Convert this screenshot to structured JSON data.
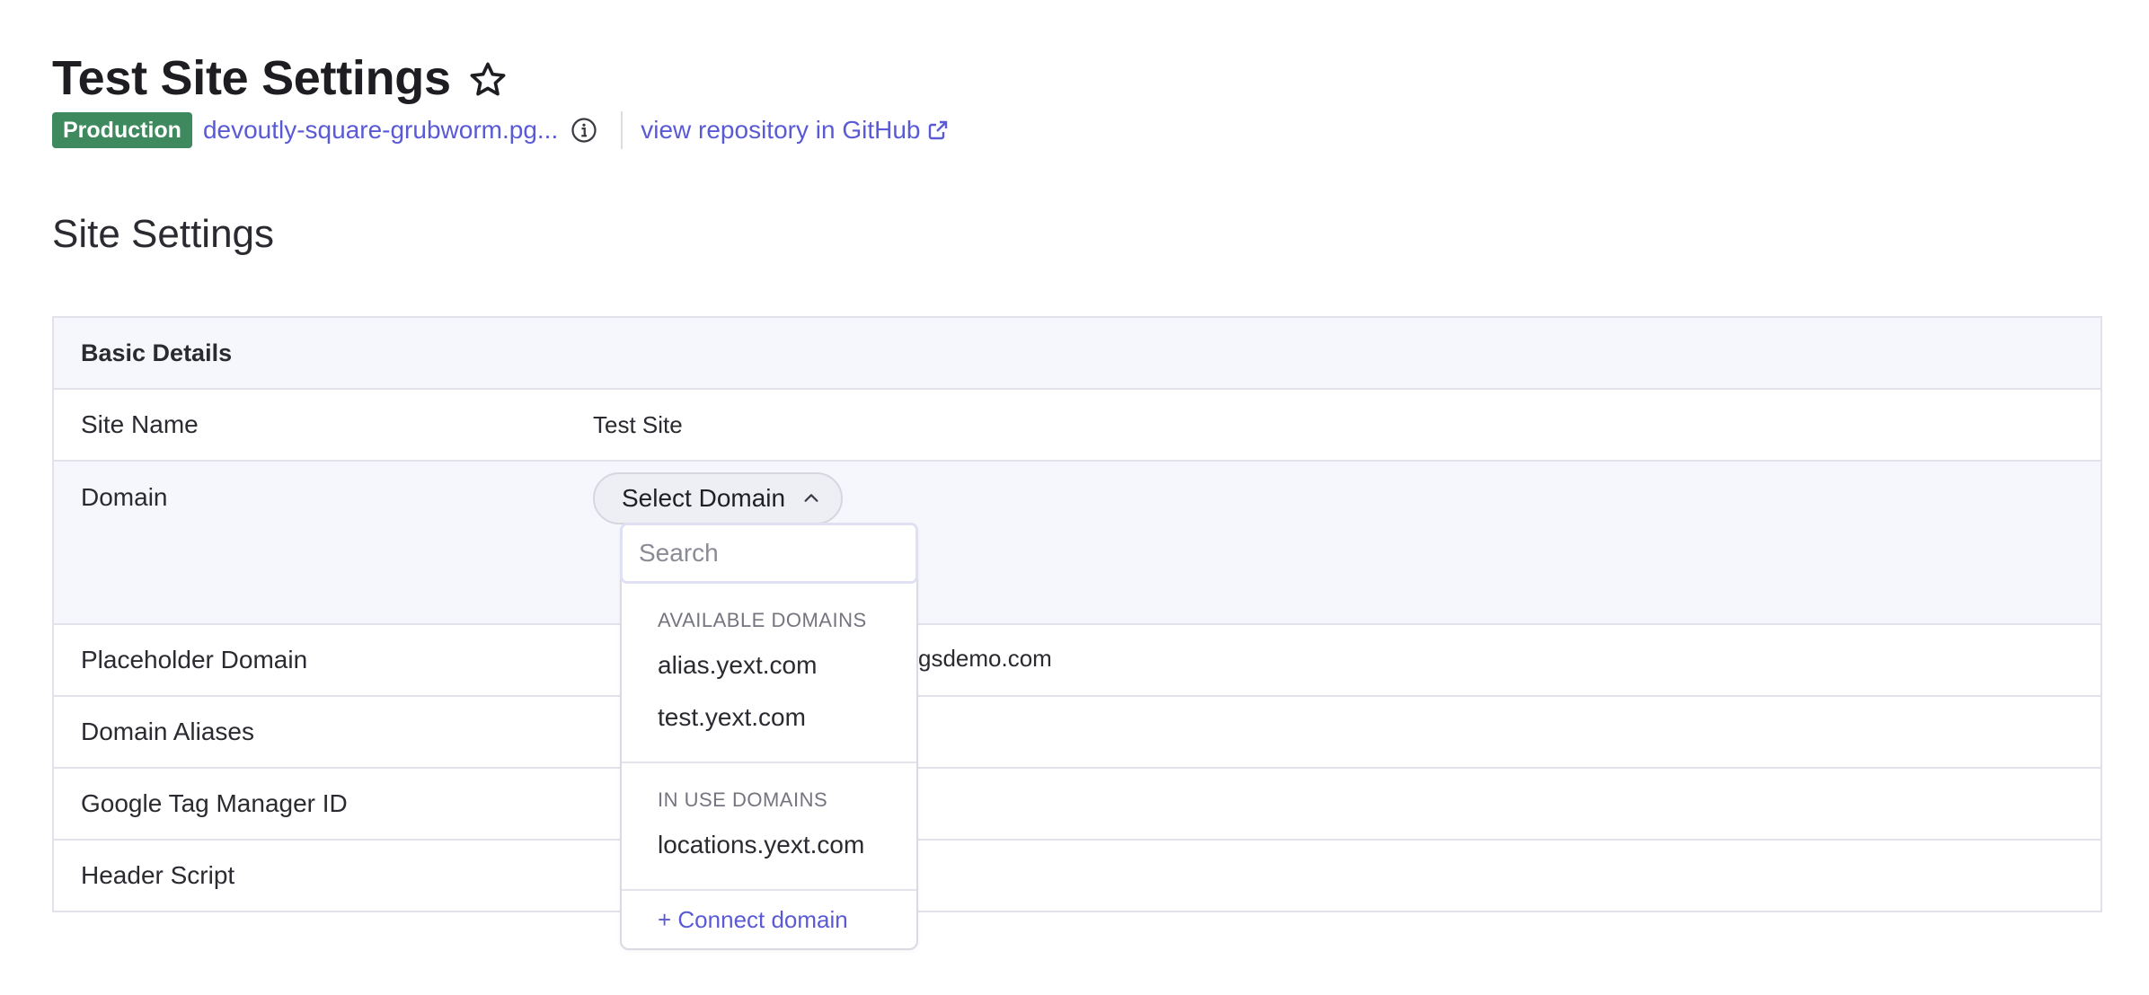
{
  "header": {
    "title": "Test Site Settings",
    "environment_badge": "Production",
    "site_link": "devoutly-square-grubworm.pg...",
    "github_link": "view repository in GitHub"
  },
  "section_title": "Site Settings",
  "table": {
    "header": "Basic Details",
    "rows": [
      {
        "label": "Site Name",
        "value": "Test Site"
      },
      {
        "label": "Domain",
        "value": ""
      },
      {
        "label": "Placeholder Domain",
        "value": "gsdemo.com"
      },
      {
        "label": "Domain Aliases",
        "value": ""
      },
      {
        "label": "Google Tag Manager ID",
        "value": ""
      },
      {
        "label": "Header Script",
        "value": ""
      }
    ]
  },
  "domain_select": {
    "label": "Select Domain",
    "search_placeholder": "Search",
    "available_label": "AVAILABLE DOMAINS",
    "available": [
      "alias.yext.com",
      "test.yext.com"
    ],
    "in_use_label": "IN USE DOMAINS",
    "in_use": [
      "locations.yext.com"
    ],
    "connect_label": "+ Connect domain"
  },
  "colors": {
    "accent": "#5a5ad6",
    "badge": "#3e8a5e",
    "border": "#e2e3ea",
    "header_bg": "#f6f7fc"
  },
  "icons": {
    "favorite": "star-icon",
    "info": "info-icon",
    "external": "external-link-icon",
    "select": "chevron-up-icon"
  }
}
